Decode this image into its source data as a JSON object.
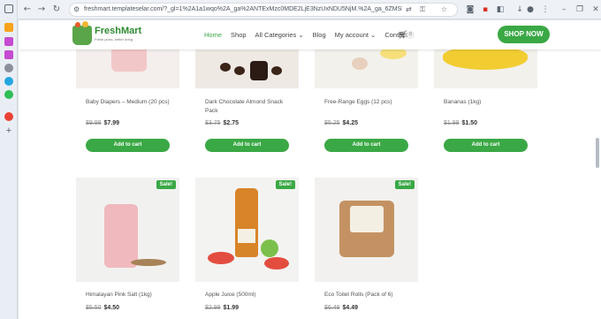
{
  "browser": {
    "url": "freshmart.templateselar.com/?_gl=1%2A1a1wqo%2A_ga%2ANTExMzc0MDE2LjE3NzUxNDU5NjM.%2A_ga_6ZMSFCR616%2AczE..."
  },
  "site": {
    "logo_name": "FreshMart",
    "logo_tagline": "Fresh picks, better living",
    "nav": [
      "Home",
      "Shop",
      "All Categories ⌄",
      "Blog",
      "My account ⌄",
      "Contact"
    ],
    "cart_count": "0",
    "cta": "SHOP NOW"
  },
  "products": [
    {
      "title": "Baby Diapers – Medium (20 pcs)",
      "old_price": "$9.99",
      "price": "$7.99",
      "button": "Add to cart"
    },
    {
      "title": "Dark Chocolate Almond Snack Pack",
      "old_price": "$3.75",
      "price": "$2.75",
      "button": "Add to cart"
    },
    {
      "title": "Free-Range Eggs (12 pcs)",
      "old_price": "$5.25",
      "price": "$4.25",
      "button": "Add to cart"
    },
    {
      "title": "Bananas (1kg)",
      "old_price": "$1.99",
      "price": "$1.50",
      "button": "Add to cart"
    },
    {
      "title": "Himalayan Pink Salt (1kg)",
      "old_price": "$5.50",
      "price": "$4.50",
      "badge": "Sale!"
    },
    {
      "title": "Apple Juice (500ml)",
      "old_price": "$2.99",
      "price": "$1.99",
      "badge": "Sale!"
    },
    {
      "title": "Eco Toilet Rolls (Pack of 6)",
      "old_price": "$6.49",
      "price": "$4.49",
      "badge": "Sale!"
    }
  ],
  "colors": {
    "brand_green": "#3aa845",
    "text": "#444444"
  }
}
